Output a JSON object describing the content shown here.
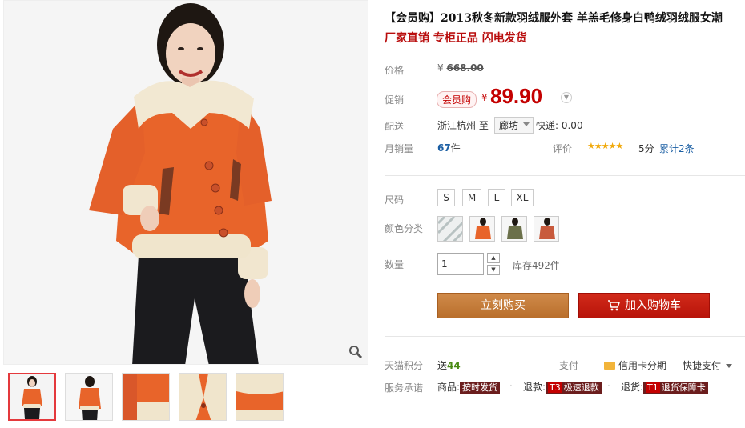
{
  "product": {
    "title": "【会员购】2013秋冬新款羽绒服外套 羊羔毛修身白鸭绒羽绒服女潮",
    "subtitle": "厂家直销 专柜正品 闪电发货"
  },
  "price": {
    "label": "价格",
    "currency": "¥",
    "original": "668.00"
  },
  "promo": {
    "label": "促销",
    "tag": "会员购",
    "currency": "¥",
    "price": "89.90"
  },
  "shipping": {
    "label": "配送",
    "from": "浙江杭州 至",
    "destination": "廊坊",
    "fee": "快递: 0.00"
  },
  "sales": {
    "label": "月销量",
    "count": "67",
    "unit": "件",
    "review_label": "评价",
    "stars": "★★★★★",
    "score": "5分",
    "total_reviews": "累计2条"
  },
  "size": {
    "label": "尺码",
    "options": [
      "S",
      "M",
      "L",
      "XL"
    ]
  },
  "color": {
    "label": "颜色分类"
  },
  "quantity": {
    "label": "数量",
    "value": "1",
    "stock": "库存492件"
  },
  "actions": {
    "buy_now": "立刻购买",
    "add_to_cart": "加入购物车"
  },
  "points": {
    "label": "天猫积分",
    "prefix": "送",
    "value": "44"
  },
  "payment": {
    "label": "支付",
    "credit": "信用卡分期",
    "fast": "快捷支付"
  },
  "service": {
    "label": "服务承诺",
    "goods_label": "商品:",
    "goods_tag": "按时发货",
    "refund_label": "退款:",
    "refund_code": "T3",
    "refund_tag": "极速退款",
    "return_label": "退货:",
    "return_code": "T1",
    "return_tag": "退货保障卡",
    "separator": "·"
  },
  "colors": {
    "accent_red": "#c40000",
    "buy_orange": "#c07a3a",
    "cart_red": "#c81d10",
    "jacket_orange": "#e8642a"
  }
}
